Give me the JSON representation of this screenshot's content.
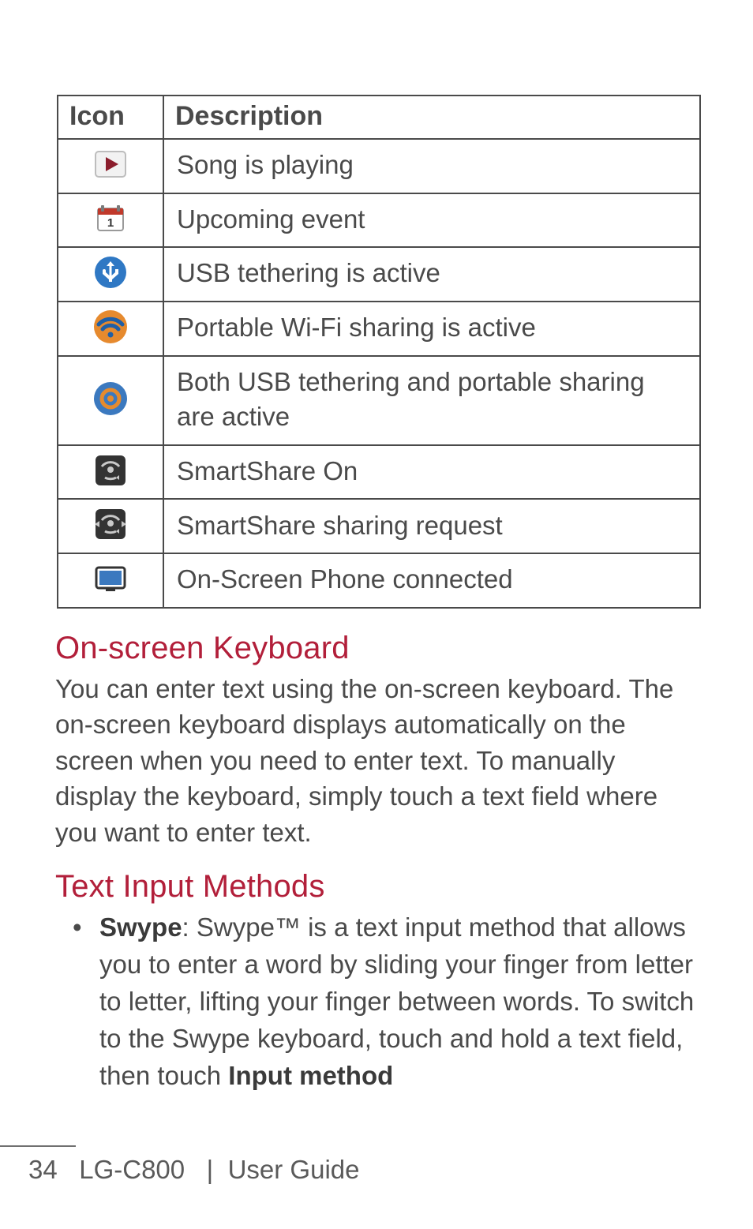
{
  "table": {
    "header_icon": "Icon",
    "header_desc": "Description",
    "rows": [
      {
        "icon": "play-icon",
        "desc": "Song is playing"
      },
      {
        "icon": "calendar-icon",
        "desc": "Upcoming event"
      },
      {
        "icon": "usb-tether-icon",
        "desc": "USB tethering is active"
      },
      {
        "icon": "wifi-share-icon",
        "desc": "Portable Wi-Fi sharing is active"
      },
      {
        "icon": "both-share-icon",
        "desc": "Both USB tethering and portable sharing are active"
      },
      {
        "icon": "smartshare-icon",
        "desc": "SmartShare On"
      },
      {
        "icon": "smartshare-req-icon",
        "desc": "SmartShare sharing request"
      },
      {
        "icon": "onscreen-phone-icon",
        "desc": "On-Screen Phone connected"
      }
    ]
  },
  "sections": {
    "keyboard_title": "On-screen Keyboard",
    "keyboard_body": "You can enter text using the on-screen keyboard. The on-screen keyboard displays automatically on the screen when you need to enter text. To manually display the keyboard, simply touch a text field where you want to enter text.",
    "input_title": "Text Input Methods",
    "swype_label": "Swype",
    "swype_body_1": ": Swype™ is a text input method that allows you to enter a word by sliding your finger from letter to letter, lifting your finger between words. To switch to the Swype keyboard, touch and hold a text field, then touch ",
    "swype_bold_tail": "Input method"
  },
  "footer": {
    "page_no": "34",
    "model": "LG-C800",
    "divider": "|",
    "guide": "User Guide"
  }
}
